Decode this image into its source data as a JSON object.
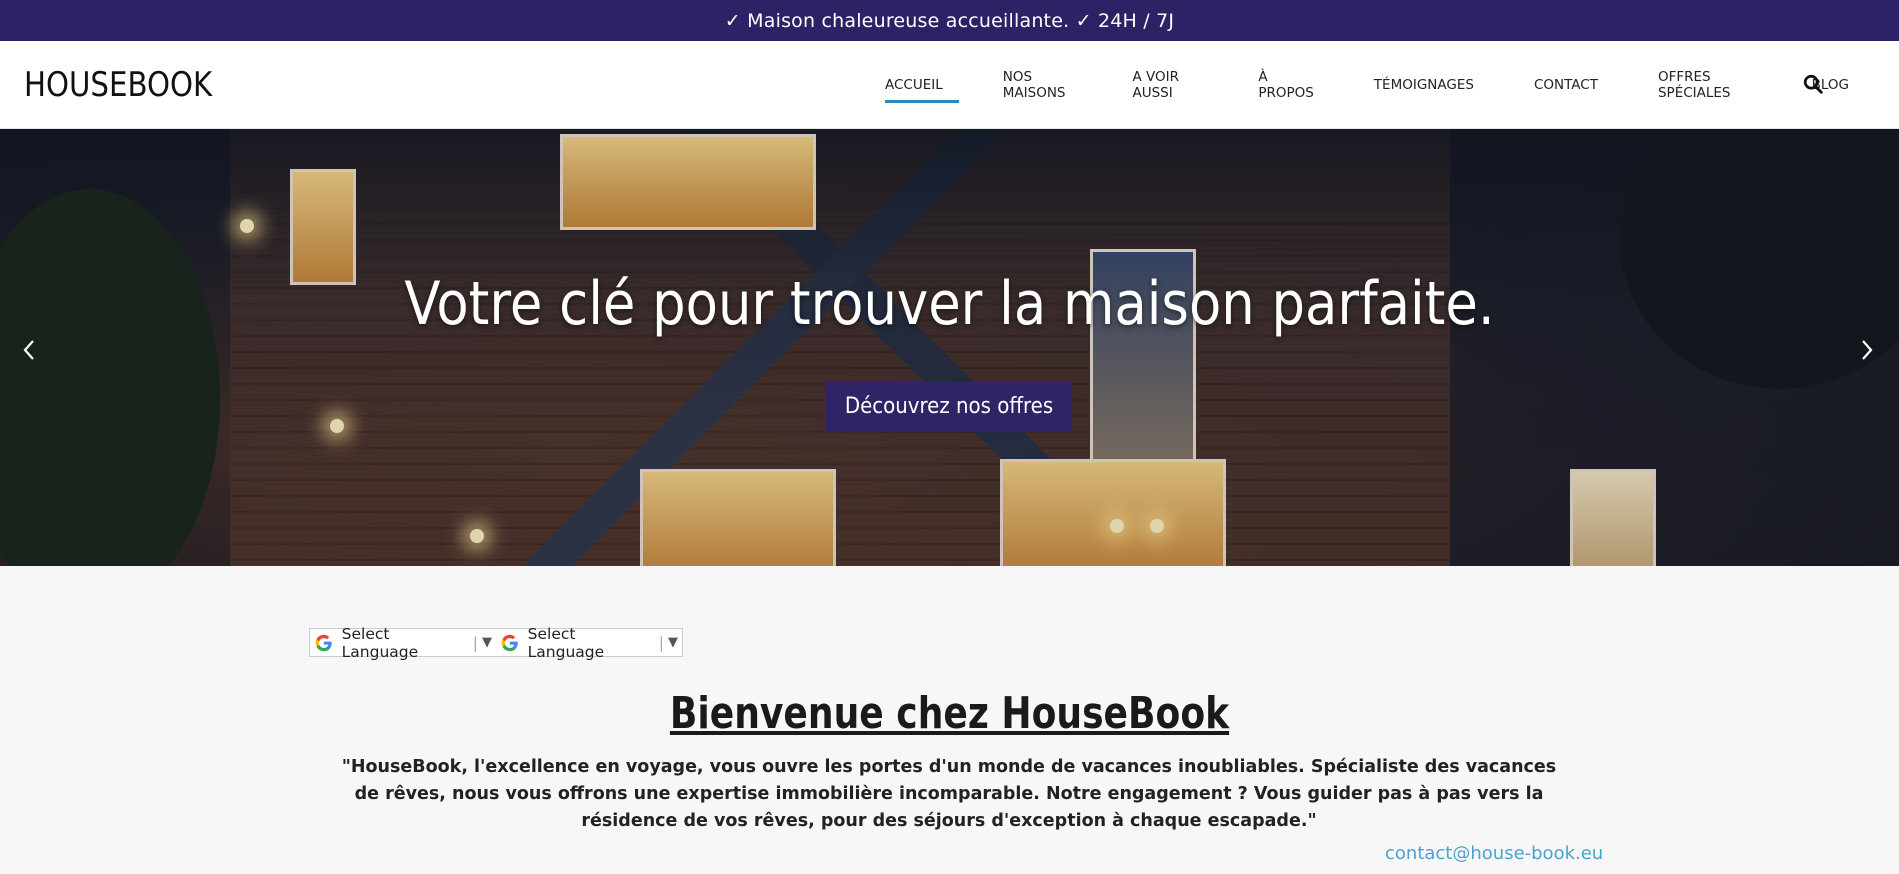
{
  "topbar": {
    "text": "✓ Maison chaleureuse accueillante. ✓ 24H / 7J"
  },
  "header": {
    "logo": "HOUSEBOOK",
    "nav": [
      {
        "label": "ACCUEIL",
        "active": true
      },
      {
        "label": "NOS MAISONS"
      },
      {
        "label": "A VOIR AUSSI"
      },
      {
        "label": "À PROPOS"
      },
      {
        "label": "TÉMOIGNAGES"
      },
      {
        "label": "CONTACT"
      },
      {
        "label": "OFFRES SPÉCIALES"
      },
      {
        "label": "BLOG"
      }
    ],
    "search_icon": "search-icon"
  },
  "hero": {
    "title": "Votre clé pour trouver la maison parfaite.",
    "button": "Découvrez nos offres",
    "prev_icon": "chevron-left-icon",
    "next_icon": "chevron-right-icon"
  },
  "language": {
    "selectors": [
      {
        "label": "Select Language",
        "dropdown": "▼"
      },
      {
        "label": "Select Language",
        "dropdown": "▼"
      }
    ]
  },
  "welcome": {
    "title": "Bienvenue chez HouseBook",
    "intro": "\"HouseBook, l'excellence en voyage, vous ouvre les portes d'un monde de vacances inoubliables. Spécialiste des vacances de rêves, nous vous offrons une expertise immobilière incomparable. Notre engagement ? Vous guider pas à pas vers la résidence de vos rêves, pour des séjours d'exception à chaque escapade.\"",
    "email": "contact@house-book.eu"
  },
  "colors": {
    "topbar": "#2d2266",
    "accent": "#2b8bb8",
    "button": "#2f2566",
    "link": "#4aa3cf"
  }
}
